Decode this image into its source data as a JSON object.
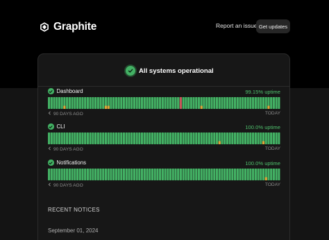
{
  "brand": {
    "name": "Graphite"
  },
  "nav": {
    "report_label": "Report an issue",
    "updates_label": "Get updates"
  },
  "status": {
    "overall_label": "All systems operational"
  },
  "colors": {
    "operational": "#43b164",
    "partial": "#e0a437",
    "outage": "#c8555a",
    "uptime_text": "#4fc16d"
  },
  "components": [
    {
      "name": "Dashboard",
      "uptime": "99.15% uptime",
      "days_label": "90 DAYS AGO",
      "today_label": "TODAY",
      "marks": [
        {
          "day": 6,
          "status": "partial"
        },
        {
          "day": 22,
          "status": "partial"
        },
        {
          "day": 23,
          "status": "partial"
        },
        {
          "day": 51,
          "status": "outage"
        },
        {
          "day": 59,
          "status": "partial"
        },
        {
          "day": 85,
          "status": "partial"
        }
      ]
    },
    {
      "name": "CLI",
      "uptime": "100.0% uptime",
      "days_label": "90 DAYS AGO",
      "today_label": "TODAY",
      "marks": [
        {
          "day": 66,
          "status": "partial"
        },
        {
          "day": 83,
          "status": "partial"
        }
      ]
    },
    {
      "name": "Notifications",
      "uptime": "100.0% uptime",
      "days_label": "90 DAYS AGO",
      "today_label": "TODAY",
      "marks": [
        {
          "day": 84,
          "status": "partial"
        }
      ]
    }
  ],
  "notices": {
    "title": "RECENT NOTICES",
    "items": [
      {
        "date": "September 01, 2024"
      }
    ]
  }
}
